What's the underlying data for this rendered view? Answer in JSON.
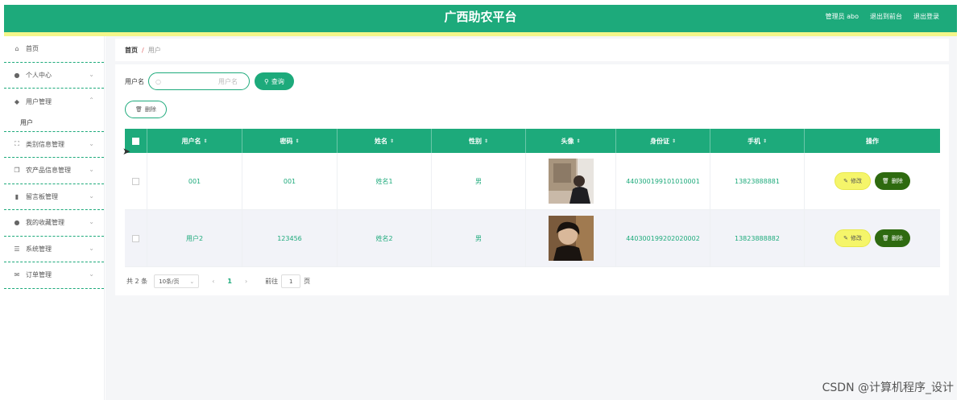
{
  "header": {
    "title": "广西助农平台",
    "links": [
      "管理员 abo",
      "退出到前台",
      "退出登录"
    ]
  },
  "sidebar": {
    "items": [
      {
        "label": "首页",
        "icon": "home-icon"
      },
      {
        "label": "个人中心",
        "icon": "user-icon"
      },
      {
        "label": "用户管理",
        "icon": "pin-icon"
      },
      {
        "label": "类别信息管理",
        "icon": "expand-icon"
      },
      {
        "label": "农产品信息管理",
        "icon": "copy-icon"
      },
      {
        "label": "留言板管理",
        "icon": "bar-chart-icon"
      },
      {
        "label": "我的收藏管理",
        "icon": "user-icon"
      },
      {
        "label": "系统管理",
        "icon": "sliders-icon"
      },
      {
        "label": "订单管理",
        "icon": "mail-icon"
      }
    ],
    "sub_item": "用户"
  },
  "breadcrumb": {
    "home": "首页",
    "sep": "/",
    "current": "用户"
  },
  "search": {
    "label": "用户名",
    "placeholder": "用户名",
    "button": "查询"
  },
  "toolbar": {
    "delete_label": "删除"
  },
  "table": {
    "columns": [
      "用户名",
      "密码",
      "姓名",
      "性别",
      "头像",
      "身份证",
      "手机",
      "操作"
    ],
    "rows": [
      {
        "username": "001",
        "password": "001",
        "name": "姓名1",
        "gender": "男",
        "id_card": "440300199101010001",
        "phone": "13823888881"
      },
      {
        "username": "用户2",
        "password": "123456",
        "name": "姓名2",
        "gender": "男",
        "id_card": "440300199202020002",
        "phone": "13823888882"
      }
    ],
    "edit_label": "修改",
    "delete_label": "删除"
  },
  "pagination": {
    "total": "共 2 条",
    "page_size": "10条/页",
    "prev": "‹",
    "current_page": "1",
    "next": "›",
    "goto_label": "前往",
    "goto_value": "1",
    "page_suffix": "页"
  },
  "watermark": "CSDN @计算机程序_设计",
  "colors": {
    "primary": "#1daa7b",
    "accent_strip": "#f3f68a",
    "edit": "#f5f56a",
    "delete": "#2e6a10"
  }
}
